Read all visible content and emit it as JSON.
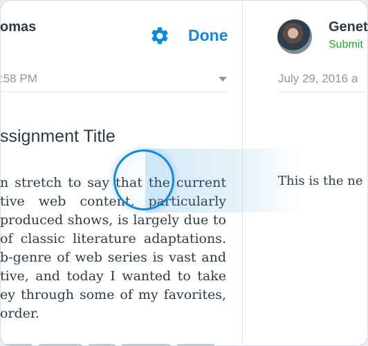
{
  "left_panel": {
    "student_name": "omas",
    "timestamp": ":58 PM",
    "done_label": "Done",
    "assignment_title": "ssignment Title",
    "body_lines": [
      "n stretch to say that the current",
      "tive web content, particularly",
      "produced shows, is largely due to",
      "of classic literature adaptations.",
      "b-genre of web series is vast and",
      "tive, and today I wanted to take",
      "ey through some of my favorites,",
      "order."
    ]
  },
  "right_panel": {
    "student_name": "Genet",
    "status": "Submit",
    "date": "July 29, 2016 a",
    "body_text": "This is the ne"
  },
  "icons": {
    "settings": "gear-icon",
    "dropdown": "chevron-down-icon",
    "touch": "touch-indicator"
  },
  "colors": {
    "accent": "#1188d6",
    "status_submitted": "#1faa2d",
    "text": "#2d3b45",
    "muted": "#8b969e"
  }
}
